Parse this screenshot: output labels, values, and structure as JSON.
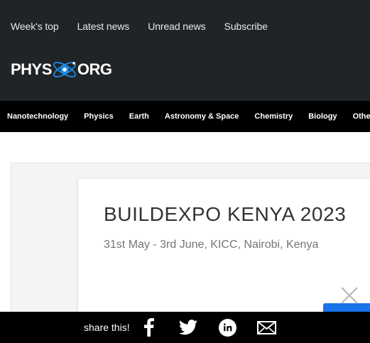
{
  "header": {
    "links": [
      "Week's top",
      "Latest news",
      "Unread news",
      "Subscribe"
    ],
    "logo": {
      "left_text": "PHYS",
      "right_text": "ORG"
    }
  },
  "categories": [
    "Nanotechnology",
    "Physics",
    "Earth",
    "Astronomy & Space",
    "Chemistry",
    "Biology",
    "Other Sciences"
  ],
  "ad": {
    "title": "BUILDEXPO KENYA 2023",
    "subtitle": "31st May - 3rd June, KICC, Nairobi, Kenya"
  },
  "share": {
    "label": "share this!",
    "icons": [
      "facebook-icon",
      "twitter-icon",
      "linkedin-icon",
      "email-icon"
    ]
  },
  "colors": {
    "header_bg": "#212427",
    "category_bg": "#000000",
    "logo_accent": "#1e88e5",
    "ad_button": "#1a73e8"
  }
}
